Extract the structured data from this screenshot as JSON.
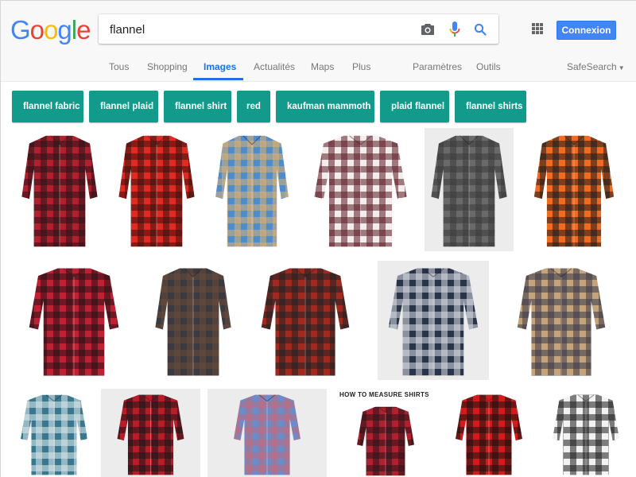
{
  "header": {
    "logo": {
      "letters": [
        {
          "ch": "G",
          "color": "#4285f4"
        },
        {
          "ch": "o",
          "color": "#ea4335"
        },
        {
          "ch": "o",
          "color": "#fbbc05"
        },
        {
          "ch": "g",
          "color": "#4285f4"
        },
        {
          "ch": "l",
          "color": "#34a853"
        },
        {
          "ch": "e",
          "color": "#ea4335"
        }
      ]
    },
    "search": {
      "value": "flannel",
      "icons": [
        "camera-icon",
        "microphone-icon",
        "search-icon"
      ]
    },
    "apps_icon": "apps-grid-icon",
    "signin_label": "Connexion"
  },
  "nav": {
    "tabs": [
      {
        "label": "Tous",
        "active": false
      },
      {
        "label": "Shopping",
        "active": false
      },
      {
        "label": "Images",
        "active": true
      },
      {
        "label": "Actualités",
        "active": false
      },
      {
        "label": "Maps",
        "active": false
      },
      {
        "label": "Plus",
        "active": false
      },
      {
        "label": "Paramètres",
        "active": false
      },
      {
        "label": "Outils",
        "active": false
      }
    ],
    "safesearch_label": "SafeSearch"
  },
  "chips": [
    "flannel fabric",
    "flannel plaid",
    "flannel shirt",
    "red",
    "kaufman mammoth",
    "plaid flannel",
    "flannel shirts"
  ],
  "results": {
    "rows": [
      [
        {
          "desc": "red and black buffalo plaid women's flannel shirt",
          "colors": [
            "#b0202e",
            "#2a1418"
          ]
        },
        {
          "desc": "bright red tartan flannel shirt",
          "colors": [
            "#e02a22",
            "#3a1010"
          ]
        },
        {
          "desc": "blue and tan plaid flannel shirt",
          "colors": [
            "#4f8ccc",
            "#d8b070"
          ]
        },
        {
          "desc": "burgundy and white plaid flannel shirt",
          "colors": [
            "#f4eded",
            "#5a1a22"
          ]
        },
        {
          "desc": "gray plaid shirt on gray background",
          "colors": [
            "#6a6a6a",
            "#3a3a3a"
          ]
        },
        {
          "desc": "orange and black buffalo plaid shirt on model",
          "colors": [
            "#f26a22",
            "#1c1c1c"
          ]
        }
      ],
      [
        {
          "desc": "red and black buffalo check flannel shirt",
          "colors": [
            "#c02034",
            "#2a1218"
          ]
        },
        {
          "desc": "man wearing dark green tartan flannel shirt",
          "colors": [
            "#3a3a40",
            "#6a4a3a"
          ]
        },
        {
          "desc": "woman wearing oversized red flannel shirt",
          "colors": [
            "#a02a22",
            "#222"
          ]
        },
        {
          "desc": "navy and white plaid flannel shirt",
          "colors": [
            "#2a3448",
            "#d8dce4"
          ]
        },
        {
          "desc": "tan and navy plaid flannel shirt",
          "colors": [
            "#c4a47a",
            "#3a3a4a"
          ]
        }
      ],
      [
        {
          "desc": "teal and white plaid flannel shirt",
          "colors": [
            "#3a7890",
            "#e0e8ec"
          ]
        },
        {
          "desc": "woman wearing red and black plaid flannel",
          "colors": [
            "#b81c28",
            "#1c1418"
          ]
        },
        {
          "desc": "blue and red plaid button-down shirt",
          "colors": [
            "#6a8ccc",
            "#c06a7a"
          ]
        },
        {
          "desc": "how to measure shirts guide",
          "title": "HOW TO MEASURE SHIRTS",
          "colors": [
            "#b0202e",
            "#2a1418"
          ]
        },
        {
          "desc": "red and black buffalo plaid flannel shirt",
          "colors": [
            "#d01c1c",
            "#1c1010"
          ]
        },
        {
          "desc": "black and white plaid flannel shirt",
          "colors": [
            "#f2f2f2",
            "#1c1c1c"
          ]
        }
      ]
    ]
  }
}
